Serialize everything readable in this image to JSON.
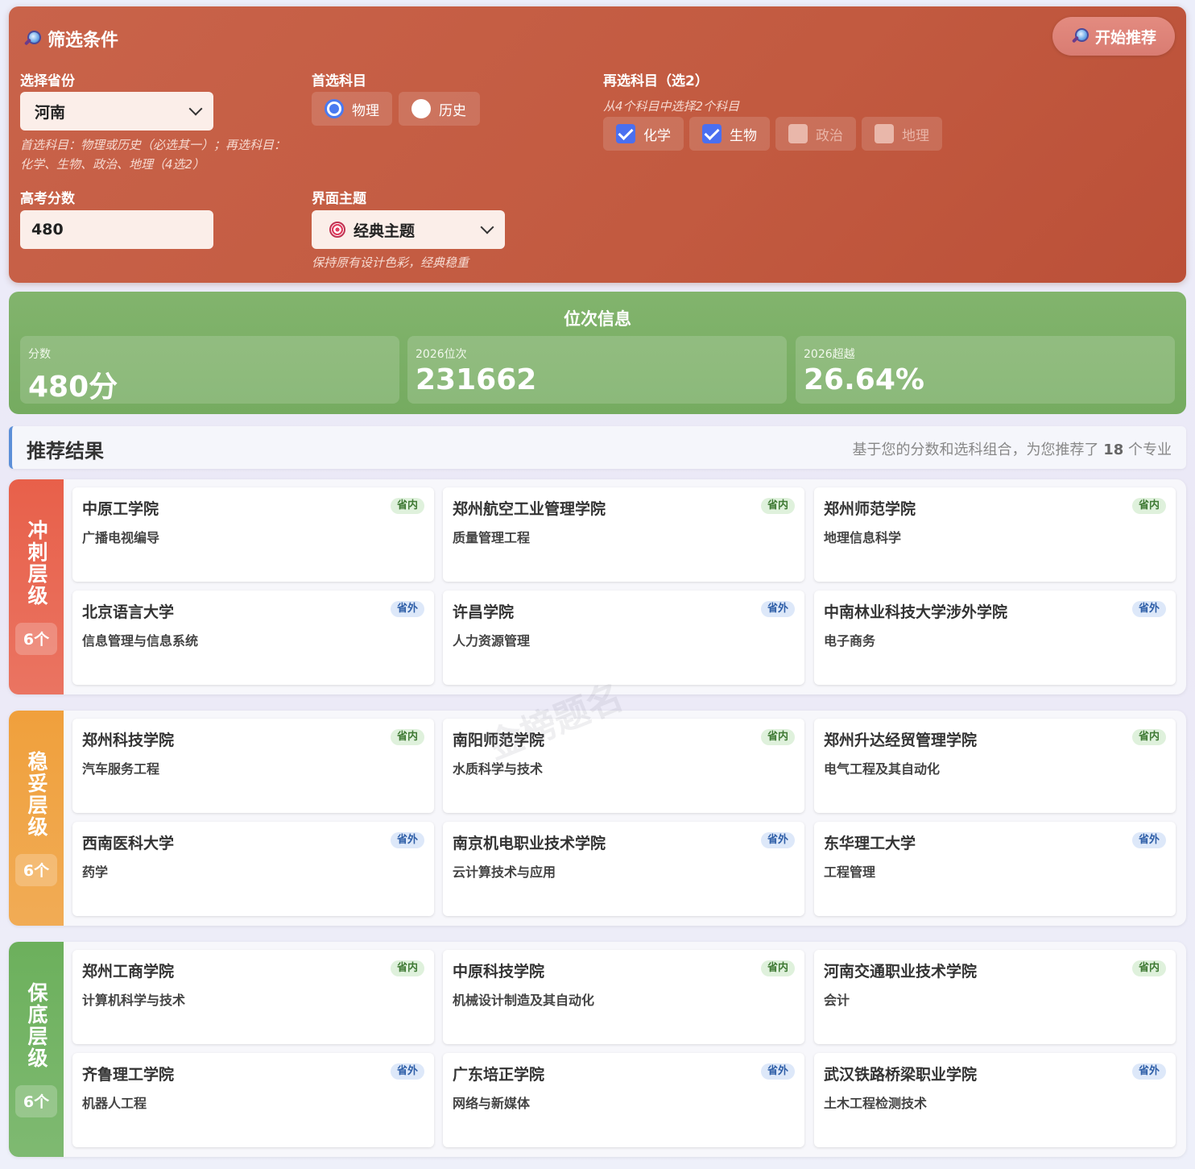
{
  "filter": {
    "title": "筛选条件",
    "start_button": "开始推荐",
    "province_label": "选择省份",
    "province_value": "河南",
    "province_hint": "首选科目：物理或历史（必选其一）；再选科目：化学、生物、政治、地理（4选2）",
    "primary_label": "首选科目",
    "primary_options": [
      {
        "label": "物理",
        "selected": true
      },
      {
        "label": "历史",
        "selected": false
      }
    ],
    "secondary_label": "再选科目（选2）",
    "secondary_hint": "从4个科目中选择2个科目",
    "secondary_options": [
      {
        "label": "化学",
        "checked": true
      },
      {
        "label": "生物",
        "checked": true
      },
      {
        "label": "政治",
        "checked": false
      },
      {
        "label": "地理",
        "checked": false
      }
    ],
    "score_label": "高考分数",
    "score_value": "480",
    "theme_label": "界面主题",
    "theme_value": "经典主题",
    "theme_hint": "保持原有设计色彩，经典稳重"
  },
  "rank": {
    "title": "位次信息",
    "cards": [
      {
        "label": "分数",
        "value": "480分"
      },
      {
        "label": "2026位次",
        "value": "231662"
      },
      {
        "label": "2026超越",
        "value": "26.64%"
      }
    ]
  },
  "results": {
    "title": "推荐结果",
    "subtitle_prefix": "基于您的分数和选科组合，为您推荐了",
    "count": "18",
    "subtitle_suffix": "个专业"
  },
  "tiers": [
    {
      "name": "冲刺层级",
      "count": "6个",
      "color": "#e8604a",
      "cards": [
        {
          "school": "中原工学院",
          "major": "广播电视编导",
          "tag": "省内"
        },
        {
          "school": "郑州航空工业管理学院",
          "major": "质量管理工程",
          "tag": "省内"
        },
        {
          "school": "郑州师范学院",
          "major": "地理信息科学",
          "tag": "省内"
        },
        {
          "school": "北京语言大学",
          "major": "信息管理与信息系统",
          "tag": "省外"
        },
        {
          "school": "许昌学院",
          "major": "人力资源管理",
          "tag": "省外"
        },
        {
          "school": "中南林业科技大学涉外学院",
          "major": "电子商务",
          "tag": "省外"
        }
      ]
    },
    {
      "name": "稳妥层级",
      "count": "6个",
      "color": "#f0a03c",
      "cards": [
        {
          "school": "郑州科技学院",
          "major": "汽车服务工程",
          "tag": "省内"
        },
        {
          "school": "南阳师范学院",
          "major": "水质科学与技术",
          "tag": "省内"
        },
        {
          "school": "郑州升达经贸管理学院",
          "major": "电气工程及其自动化",
          "tag": "省内"
        },
        {
          "school": "西南医科大学",
          "major": "药学",
          "tag": "省外"
        },
        {
          "school": "南京机电职业技术学院",
          "major": "云计算技术与应用",
          "tag": "省外"
        },
        {
          "school": "东华理工大学",
          "major": "工程管理",
          "tag": "省外"
        }
      ]
    },
    {
      "name": "保底层级",
      "count": "6个",
      "color": "#6cb05c",
      "cards": [
        {
          "school": "郑州工商学院",
          "major": "计算机科学与技术",
          "tag": "省内"
        },
        {
          "school": "中原科技学院",
          "major": "机械设计制造及其自动化",
          "tag": "省内"
        },
        {
          "school": "河南交通职业技术学院",
          "major": "会计",
          "tag": "省内"
        },
        {
          "school": "齐鲁理工学院",
          "major": "机器人工程",
          "tag": "省外"
        },
        {
          "school": "广东培正学院",
          "major": "网络与新媒体",
          "tag": "省外"
        },
        {
          "school": "武汉铁路桥梁职业学院",
          "major": "土木工程检测技术",
          "tag": "省外"
        }
      ]
    }
  ],
  "watermark": "金榜题名"
}
